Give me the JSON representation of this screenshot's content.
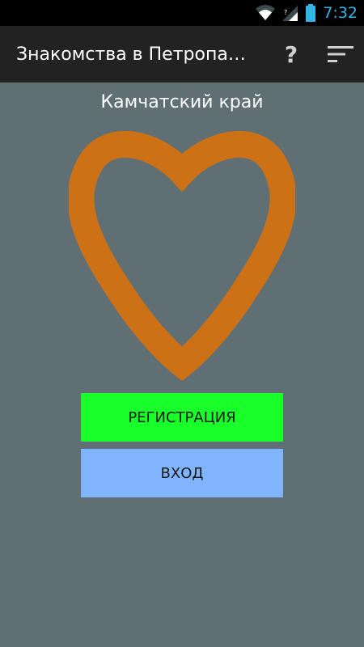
{
  "status_bar": {
    "time": "7:32",
    "icons": [
      "wifi-icon",
      "cell-signal-icon",
      "battery-icon"
    ],
    "colors": {
      "background": "#000000",
      "time": "#33b5e5"
    }
  },
  "action_bar": {
    "title": "Знакомства в Петропавловске-Камчатском",
    "help_label": "?",
    "icons": [
      "help-icon",
      "sort-menu-icon"
    ],
    "background": "#222222"
  },
  "main": {
    "region": "Камчатский край",
    "logo_icon": "heart-outline-icon",
    "register_label": "РЕГИСТРАЦИЯ",
    "login_label": "ВХОД",
    "colors": {
      "background": "#5f6f74",
      "heart": "#cd7117",
      "register_button": "#19ff2a",
      "login_button": "#80b4ff"
    }
  }
}
